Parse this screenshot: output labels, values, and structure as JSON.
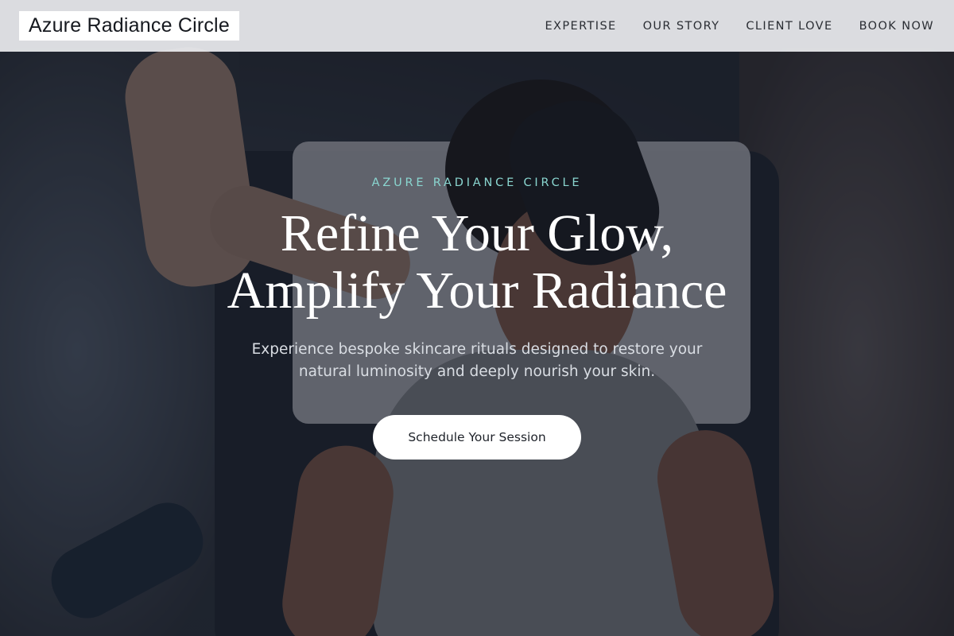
{
  "header": {
    "logo": "Azure Radiance Circle",
    "nav": [
      {
        "label": "EXPERTISE"
      },
      {
        "label": "OUR STORY"
      },
      {
        "label": "CLIENT LOVE"
      },
      {
        "label": "BOOK NOW"
      }
    ]
  },
  "hero": {
    "eyebrow": "AZURE RADIANCE CIRCLE",
    "headline_line1": "Refine Your Glow,",
    "headline_line2": "Amplify Your Radiance",
    "subtext_line1": "Experience bespoke skincare rituals designed to restore your",
    "subtext_line2": "natural luminosity and deeply nourish your skin.",
    "cta_label": "Schedule Your Session",
    "background_image": "facial-treatment-photo"
  },
  "colors": {
    "accent": "#8ad6d0",
    "header_bg": "#ecedf0",
    "overlay": "#141822"
  }
}
